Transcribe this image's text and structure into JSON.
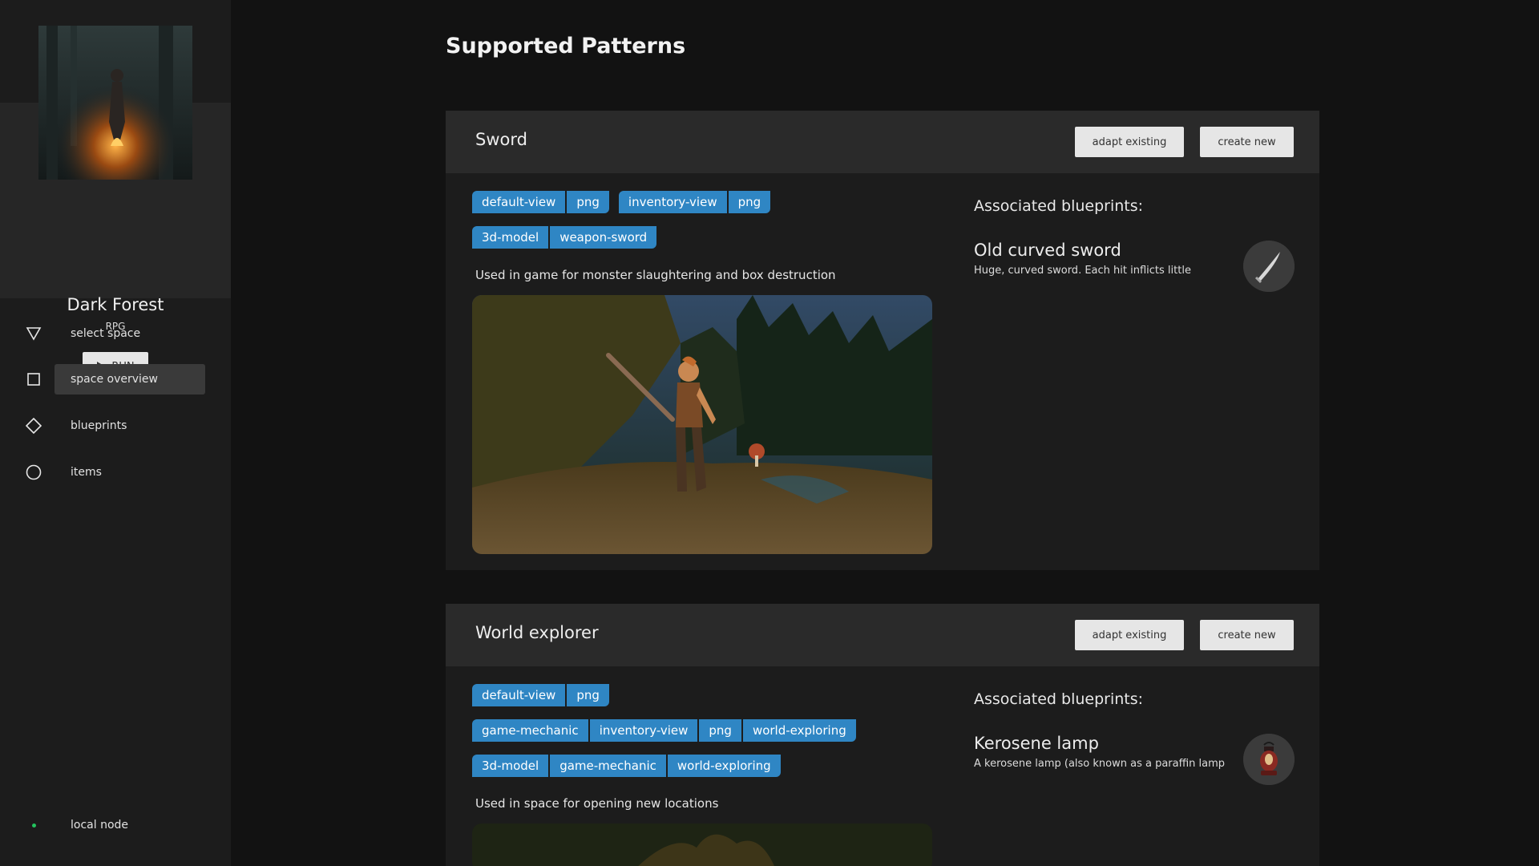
{
  "sidebar": {
    "space": {
      "name": "Dark Forest",
      "genre": "RPG",
      "run_label": "RUN"
    },
    "nav": [
      {
        "label": "select space",
        "icon": "triangle-down-icon"
      },
      {
        "label": "space overview",
        "icon": "square-icon",
        "active": true
      },
      {
        "label": "blueprints",
        "icon": "diamond-icon"
      },
      {
        "label": "items",
        "icon": "circle-icon"
      }
    ],
    "node": {
      "label": "local node",
      "status_color": "#23c45e"
    }
  },
  "main": {
    "title": "Supported Patterns",
    "patterns": [
      {
        "name": "Sword",
        "adapt_label": "adapt existing",
        "create_label": "create new",
        "tags": [
          [
            "default-view",
            "png"
          ],
          [
            "inventory-view",
            "png"
          ],
          [
            "3d-model",
            "weapon-sword"
          ]
        ],
        "description": "Used in game for monster slaughtering and box destruction",
        "assoc_title": "Associated blueprints:",
        "blueprints": [
          {
            "name": "Old curved sword",
            "description": "Huge, curved sword. Each hit inflicts little",
            "icon": "sword-icon"
          }
        ]
      },
      {
        "name": "World explorer",
        "adapt_label": "adapt existing",
        "create_label": "create new",
        "tags": [
          [
            "default-view",
            "png"
          ],
          [
            "game-mechanic",
            "inventory-view",
            "png",
            "world-exploring"
          ],
          [
            "3d-model",
            "game-mechanic",
            "world-exploring"
          ]
        ],
        "description": "Used in space for opening new locations",
        "assoc_title": "Associated blueprints:",
        "blueprints": [
          {
            "name": "Kerosene lamp",
            "description": "A kerosene lamp (also known as a paraffin lamp",
            "icon": "lamp-icon"
          }
        ]
      }
    ]
  },
  "colors": {
    "tag": "#2f86c4",
    "background": "#121212",
    "card": "#1c1c1c",
    "card_header": "#2a2a2a",
    "sidebar": "#1c1c1c"
  }
}
